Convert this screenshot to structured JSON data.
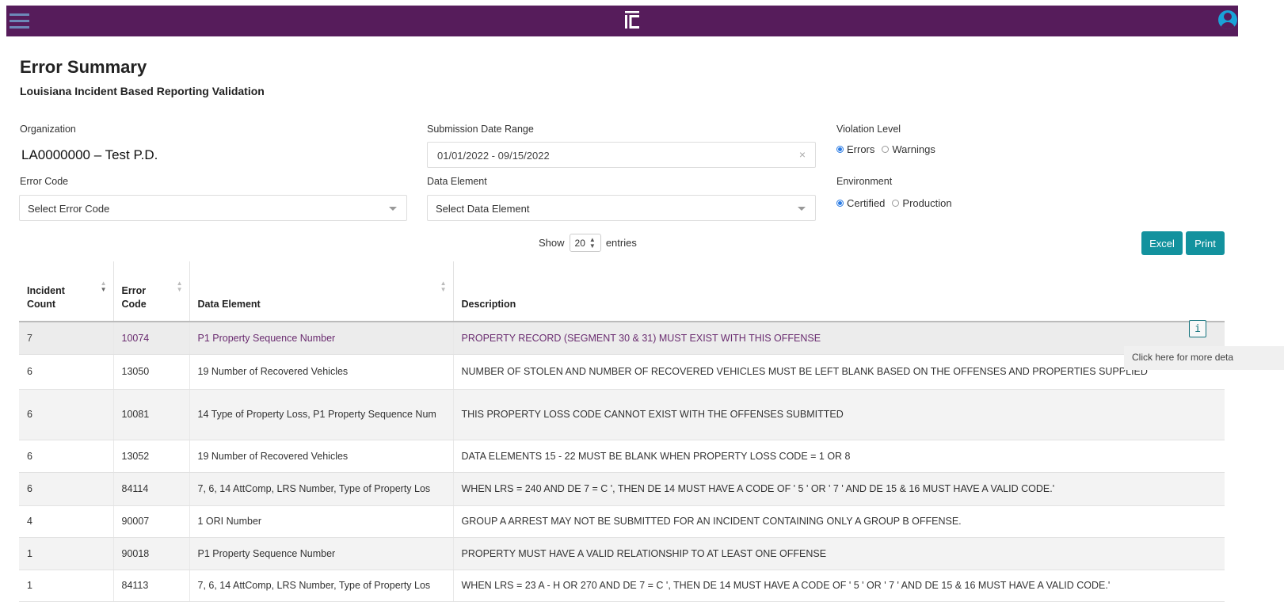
{
  "header": {
    "logo_icon": "brand-logo-icon",
    "menu_icon": "hamburger-menu-icon",
    "user_icon": "user-avatar-icon"
  },
  "page": {
    "title": "Error Summary",
    "subtitle": "Louisiana Incident Based Reporting Validation"
  },
  "filters": {
    "organization_label": "Organization",
    "organization_value": "LA0000000 – Test P.D.",
    "date_range_label": "Submission Date Range",
    "date_range_value": "01/01/2022 - 09/15/2022",
    "date_clear": "×",
    "violation_level_label": "Violation Level",
    "violation_options": [
      "Errors",
      "Warnings"
    ],
    "violation_selected": "Errors",
    "error_code_label": "Error Code",
    "error_code_placeholder": "Select Error Code",
    "data_element_label": "Data Element",
    "data_element_placeholder": "Select Data Element",
    "environment_label": "Environment",
    "environment_options": [
      "Certified",
      "Production"
    ],
    "environment_selected": "Certified"
  },
  "table_controls": {
    "show_label": "Show",
    "entries_value": "20",
    "entries_label": "entries",
    "excel_label": "Excel",
    "print_label": "Print"
  },
  "table": {
    "columns": [
      "Incident Count",
      "Error Code",
      "Data Element",
      "Description"
    ],
    "rows": [
      {
        "count": "7",
        "code": "10074",
        "element": "P1 Property Sequence Number",
        "description": "PROPERTY RECORD (SEGMENT 30 & 31) MUST EXIST WITH THIS OFFENSE"
      },
      {
        "count": "6",
        "code": "13050",
        "element": "19 Number of Recovered Vehicles",
        "description": "NUMBER OF STOLEN AND NUMBER OF RECOVERED VEHICLES MUST BE LEFT BLANK BASED ON THE OFFENSES AND PROPERTIES SUPPLIED"
      },
      {
        "count": "6",
        "code": "10081",
        "element": "14 Type of Property Loss, P1 Property Sequence Num",
        "description": "THIS PROPERTY LOSS CODE CANNOT EXIST WITH THE OFFENSES SUBMITTED"
      },
      {
        "count": "6",
        "code": "13052",
        "element": "19 Number of Recovered Vehicles",
        "description": "DATA ELEMENTS 15 - 22 MUST BE BLANK WHEN PROPERTY LOSS CODE = 1 OR 8"
      },
      {
        "count": "6",
        "code": "84114",
        "element": "7, 6, 14 AttComp, LRS Number, Type of Property Los",
        "description": "WHEN LRS = 240 AND DE 7 = C ', THEN DE 14 MUST HAVE A CODE OF ' 5 ' OR ' 7 ' AND DE 15 & 16 MUST HAVE A VALID CODE.'"
      },
      {
        "count": "4",
        "code": "90007",
        "element": "1 ORI Number",
        "description": "GROUP A ARREST MAY NOT BE SUBMITTED FOR AN INCIDENT CONTAINING ONLY A GROUP B OFFENSE."
      },
      {
        "count": "1",
        "code": "90018",
        "element": "P1 Property Sequence Number",
        "description": "PROPERTY MUST HAVE A VALID RELATIONSHIP TO AT LEAST ONE OFFENSE"
      },
      {
        "count": "1",
        "code": "84113",
        "element": "7, 6, 14 AttComp, LRS Number, Type of Property Los",
        "description": "WHEN LRS = 23 A - H OR 270 AND DE 7 = C ', THEN DE 14 MUST HAVE A CODE OF ' 5 ' OR ' 7 ' AND DE 15 & 16 MUST HAVE A VALID CODE.'"
      }
    ]
  },
  "info_button": {
    "glyph": "i",
    "icon": "info-icon"
  },
  "tooltip": {
    "text": "Click here for more deta"
  },
  "colors": {
    "header_bg": "#561c5b",
    "accent_teal": "#13929e",
    "highlight_text": "#6a2c70"
  }
}
